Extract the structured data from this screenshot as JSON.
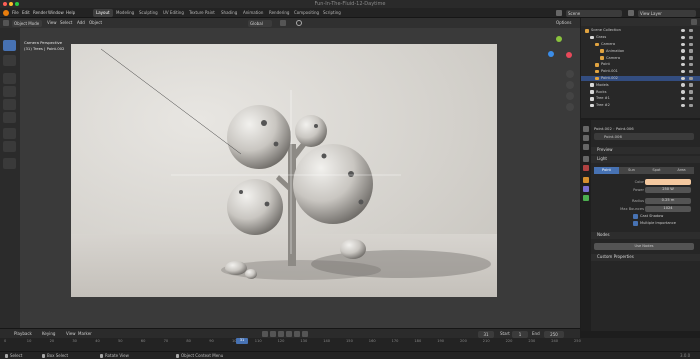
{
  "window": {
    "title": "Fun-In-The-Fluid-12-Daytime"
  },
  "menu": [
    "File",
    "Edit",
    "Render",
    "Window",
    "Help"
  ],
  "workspaces": [
    "Layout",
    "Modeling",
    "Sculpting",
    "UV Editing",
    "Texture Paint",
    "Shading",
    "Animation",
    "Rendering",
    "Compositing",
    "Scripting"
  ],
  "topright": {
    "scene": "Scene",
    "view_layer": "View Layer"
  },
  "viewport": {
    "mode": "Object Mode",
    "menus": [
      "View",
      "Select",
      "Add",
      "Object"
    ],
    "orientation": "Global",
    "options": "Options",
    "overlay_line1": "Camera Perspective",
    "overlay_line2": "(31) Trees | Point.002"
  },
  "outliner": {
    "rows": [
      {
        "label": "Scene Collection",
        "indent": 0,
        "sel": false
      },
      {
        "label": "Grass",
        "indent": 1,
        "sel": false
      },
      {
        "label": "Camera",
        "indent": 2,
        "sel": false
      },
      {
        "label": "Animation",
        "indent": 3,
        "sel": false
      },
      {
        "label": "Camera",
        "indent": 3,
        "sel": false
      },
      {
        "label": "Point",
        "indent": 2,
        "sel": false
      },
      {
        "label": "Point.001",
        "indent": 2,
        "sel": false
      },
      {
        "label": "Point.002",
        "indent": 2,
        "sel": true
      },
      {
        "label": "Models",
        "indent": 1,
        "sel": false
      },
      {
        "label": "Rocks",
        "indent": 1,
        "sel": false
      },
      {
        "label": "Tree #1",
        "indent": 1,
        "sel": false
      },
      {
        "label": "Tree #2",
        "indent": 1,
        "sel": false
      }
    ]
  },
  "properties": {
    "breadcrumb_object": "Point.002",
    "breadcrumb_data": "Point.006",
    "datablock": "Point.006",
    "sections": {
      "preview": "Preview",
      "light": "Light",
      "nodes": "Nodes",
      "custom": "Custom Properties"
    },
    "light_types": [
      "Point",
      "Sun",
      "Spot",
      "Area"
    ],
    "fields": [
      {
        "label": "Color",
        "value": ""
      },
      {
        "label": "Power",
        "value": "250 W"
      },
      {
        "label": "Radius",
        "value": "0.25 m"
      },
      {
        "label": "Max Bounces",
        "value": "1024"
      }
    ],
    "checkboxes": [
      {
        "label": "Cast Shadow",
        "checked": true
      },
      {
        "label": "Multiple Importance",
        "checked": true
      }
    ],
    "use_nodes": "Use Nodes",
    "light_color": "#f5c9a0"
  },
  "timeline": {
    "menus": [
      "Playback",
      "Keying",
      "View",
      "Marker"
    ],
    "current_frame": "31",
    "start_label": "Start",
    "start": "1",
    "end_label": "End",
    "end": "250",
    "ticks": [
      "0",
      "10",
      "20",
      "30",
      "40",
      "50",
      "60",
      "70",
      "80",
      "90",
      "100",
      "110",
      "120",
      "130",
      "140",
      "150",
      "160",
      "170",
      "180",
      "190",
      "200",
      "210",
      "220",
      "230",
      "240",
      "250"
    ]
  },
  "status": {
    "left1": "Select",
    "left2": "Box Select",
    "middle1": "Rotate View",
    "middle2": "Object Context Menu",
    "right": "3.0.0"
  },
  "colors": {
    "accent": "#4772b3",
    "selection": "#334d80",
    "playhead": "#4772b3"
  }
}
